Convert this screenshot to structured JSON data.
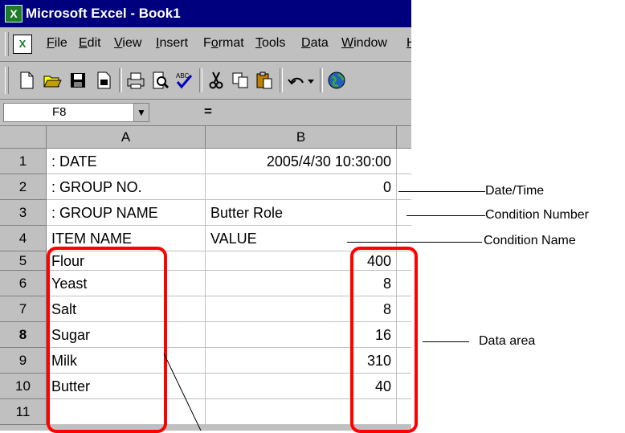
{
  "window": {
    "title": "Microsoft Excel - Book1"
  },
  "menu": [
    {
      "pre": "",
      "u": "F",
      "post": "ile"
    },
    {
      "pre": "",
      "u": "E",
      "post": "dit"
    },
    {
      "pre": "",
      "u": "V",
      "post": "iew"
    },
    {
      "pre": "",
      "u": "I",
      "post": "nsert"
    },
    {
      "pre": "F",
      "u": "o",
      "post": "rmat"
    },
    {
      "pre": "",
      "u": "T",
      "post": "ools"
    },
    {
      "pre": "",
      "u": "D",
      "post": "ata"
    },
    {
      "pre": "",
      "u": "W",
      "post": "indow"
    },
    {
      "pre": "",
      "u": "H",
      "post": ""
    }
  ],
  "formula_bar": {
    "name_box": "F8",
    "equals": "="
  },
  "columns": [
    "A",
    "B"
  ],
  "rows": [
    {
      "num": "1",
      "a": ": DATE",
      "b": "2005/4/30 10:30:00"
    },
    {
      "num": "2",
      "a": ": GROUP NO.",
      "b": "0"
    },
    {
      "num": "3",
      "a": ": GROUP NAME",
      "b": "Butter Role"
    },
    {
      "num": "4",
      "a": "ITEM NAME",
      "b": "VALUE"
    },
    {
      "num": "5",
      "a": "Flour",
      "b": "400"
    },
    {
      "num": "6",
      "a": "Yeast",
      "b": "8"
    },
    {
      "num": "7",
      "a": "Salt",
      "b": "8"
    },
    {
      "num": "8",
      "a": "Sugar",
      "b": "16"
    },
    {
      "num": "9",
      "a": "Milk",
      "b": "310"
    },
    {
      "num": "10",
      "a": "Butter",
      "b": "40"
    },
    {
      "num": "11",
      "a": "",
      "b": ""
    }
  ],
  "annotations": {
    "datetime": "Date/Time",
    "condition_number": "Condition Number",
    "condition_name": "Condition Name",
    "data_area": "Data area"
  }
}
